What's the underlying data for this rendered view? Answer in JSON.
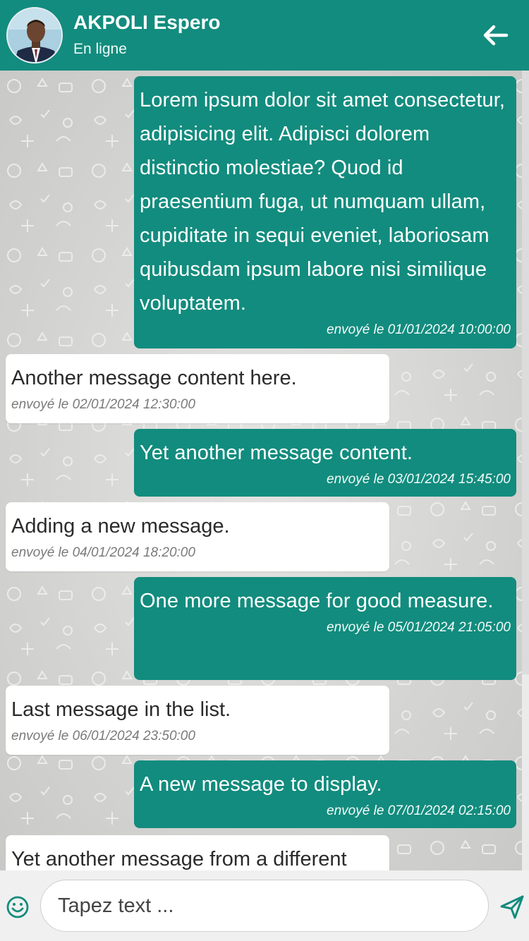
{
  "header": {
    "contact_name": "AKPOLI Espero",
    "status": "En ligne",
    "back_icon": "arrow-left-icon"
  },
  "colors": {
    "brand": "#128c7e",
    "sent_bubble": "#128c7e",
    "received_bubble": "#ffffff",
    "chat_background": "#d6d6d4"
  },
  "messages": [
    {
      "direction": "sent",
      "text": "Lorem ipsum dolor sit amet consectetur, adipisicing elit. Adipisci dolorem distinctio molestiae? Quod id praesentium fuga, ut numquam ullam, cupiditate in sequi eveniet, laboriosam quibusdam ipsum labore nisi similique voluptatem.",
      "time": "envoyé le 01/01/2024 10:00:00"
    },
    {
      "direction": "received",
      "text": "Another message content here.",
      "time": "envoyé le 02/01/2024 12:30:00"
    },
    {
      "direction": "sent",
      "text": "Yet another message content.",
      "time": "envoyé le 03/01/2024 15:45:00"
    },
    {
      "direction": "received",
      "text": "Adding a new message.",
      "time": "envoyé le 04/01/2024 18:20:00"
    },
    {
      "direction": "sent",
      "text": "One more message for good measure.",
      "time": "envoyé le 05/01/2024 21:05:00"
    },
    {
      "direction": "received",
      "text": "Last message in the list.",
      "time": "envoyé le 06/01/2024 23:50:00"
    },
    {
      "direction": "sent",
      "text": "A new message to display.",
      "time": "envoyé le 07/01/2024 02:15:00"
    },
    {
      "direction": "received",
      "text": "Yet another message from a different",
      "time": ""
    }
  ],
  "composer": {
    "placeholder": "Tapez text ...",
    "emoji_icon": "smiley-icon",
    "send_icon": "send-icon"
  }
}
